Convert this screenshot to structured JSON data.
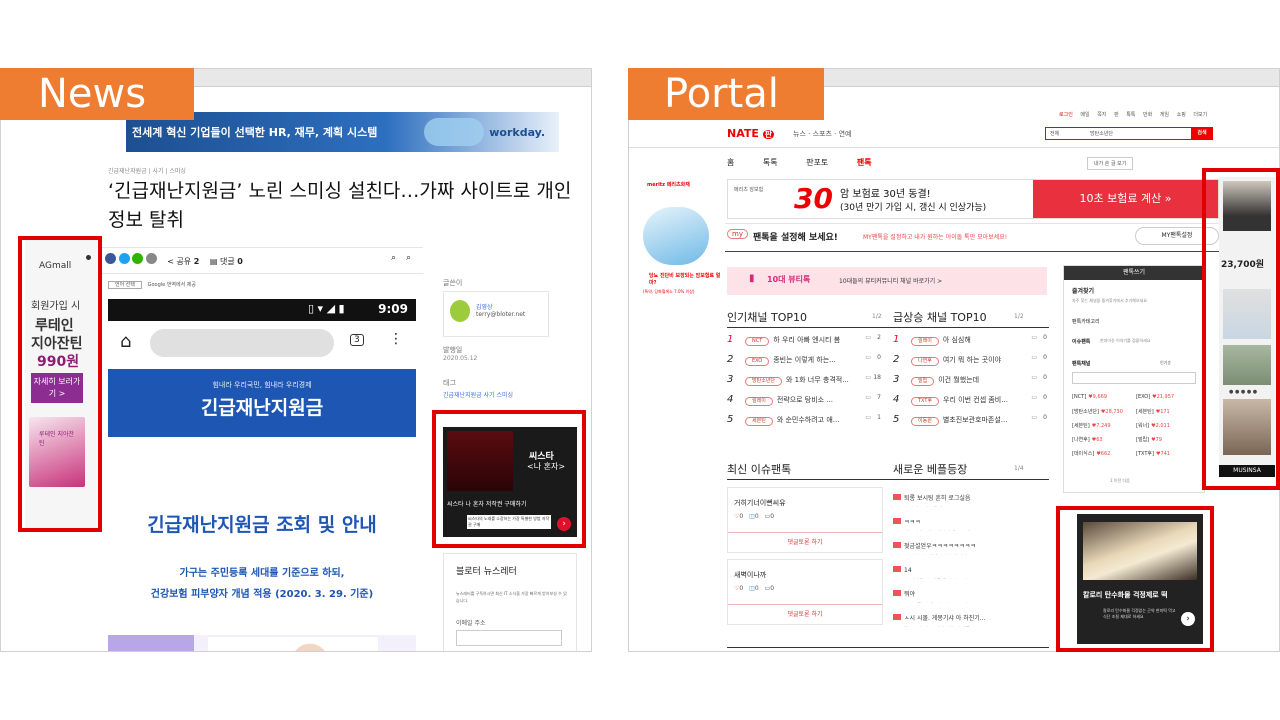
{
  "labels": {
    "news": "News",
    "portal": "Portal"
  },
  "news": {
    "top_banner": {
      "text": "전세계 혁신 기업들이 선택한 HR, 재무, 계획 시스템",
      "brand": "workday."
    },
    "breadcrumb": "긴급재난지원금 | 사기 | 스미싱",
    "headline": "‘긴급재난지원금’ 노린 스미싱 설친다…가짜 사이트로 개인정보 탈취",
    "share": {
      "share_label": "공유",
      "share_count": "2",
      "comment_label": "댓글",
      "comment_count": "0"
    },
    "translate": {
      "select": "언어 선택",
      "note": "Google 번역에서 제공"
    },
    "phone": {
      "time": "9:09",
      "tab_count": "3"
    },
    "gov_banner": {
      "tagline": "힘내라 우리국민, 힘내라 우리경제",
      "title": "긴급재난지원금"
    },
    "article_heading": "긴급재난지원금 조회 및 안내",
    "article_sub1": "가구는 주민등록 세대를 기준으로 하되,",
    "article_sub2": "건강보험 피부양자 개념 적용 (2020. 3. 29. 기준)",
    "sidebar": {
      "writer_label": "글쓴이",
      "writer_name": "김영상",
      "writer_email": "terry@bloter.net",
      "date_label": "발행일",
      "date": "2020.05.12",
      "tag_label": "태그",
      "tags": "긴급재난지원금 사기 스미싱",
      "ad_title": "씨스타",
      "ad_sub": "<나 혼자>",
      "ad_button": "씨스타 나 혼자 저작권 구매하기",
      "ad_desc": "씨스타의 노래를 소장하는 가장 특별한 방법 저작권 구매",
      "newsletter_title": "블로터 뉴스레터",
      "newsletter_desc": "뉴스레터를 구독하시면 최신 IT 소식을 가장 빠르게 받아보실 수 있습니다.",
      "email_label": "이메일 주소"
    },
    "left_ad": {
      "brand": "AGmall",
      "line1": "회원가입 시",
      "line2": "루테인",
      "line3": "지아잔틴",
      "price": "990원",
      "cta": "자세히 보러가기 >",
      "box": "루테인 지아잔틴"
    }
  },
  "portal": {
    "top_links": [
      "로그인",
      "메일",
      "쪽지",
      "판",
      "톡톡",
      "만화",
      "게임",
      "쇼핑",
      "더보기"
    ],
    "logo": {
      "nate": "NATE",
      "pan": "판"
    },
    "nav": [
      "뉴스",
      "스포츠",
      "연예"
    ],
    "search": {
      "scope": "전체",
      "query": "방탄소년단",
      "button": "검색"
    },
    "tabs": [
      "홈",
      "톡톡",
      "판포토",
      "팬톡"
    ],
    "write_button": "내가 쓴 글 보기",
    "meritz_ad": {
      "brand": "meritz 메리츠화재",
      "product": "메리츠 암보험",
      "big": "30",
      "headline": "암 보험료 30년 동결!",
      "sub": "(30년 만기 가입 시, 갱신 시 인상가능)",
      "cta": "10초 보험료 계산 »",
      "side_q": "당뇨 진단비 보장되는 암보험료 얼마?",
      "side_sub": "(특약, 당화혈색소 7.0% 이상)"
    },
    "my_bar": {
      "badge": "my",
      "text": "팬톡을 설정해 보세요!",
      "desc": "MY팬톡을 설정하고 내가 원하는 아이돌 톡만 모아보세요!",
      "button": "MY팬톡설정"
    },
    "beauty_banner": {
      "badge": "10대 뷰티톡",
      "text": "10대들의 뷰티커뮤니티 채널 바로가기 >"
    },
    "popular": {
      "title": "인기채널 TOP10",
      "page": "1/2",
      "items": [
        {
          "rank": "1",
          "channel": "NCT",
          "title": "하 우리 아빠 엔시티 봄",
          "count": "2"
        },
        {
          "rank": "2",
          "channel": "EXO",
          "title": "종빈는 이렇게 하는...",
          "count": "0"
        },
        {
          "rank": "3",
          "channel": "방탄소년단",
          "title": "와 1화 너무 충격적...",
          "count": "18"
        },
        {
          "rank": "4",
          "channel": "릴레이",
          "title": "전략으로 탕비소 ...",
          "count": "7"
        },
        {
          "rank": "5",
          "channel": "세븐틴",
          "title": "와 순민수하려고 애...",
          "count": "1"
        }
      ]
    },
    "rising": {
      "title": "급상승 채널 TOP10",
      "page": "1/2",
      "items": [
        {
          "rank": "1",
          "channel": "릴레이",
          "title": "아 심심해",
          "count": "0"
        },
        {
          "rank": "2",
          "channel": "나연후",
          "title": "여기 뭐 하는 곳이야",
          "count": "0"
        },
        {
          "rank": "3",
          "channel": "빌립",
          "title": "이건 뭘했는데",
          "count": "0"
        },
        {
          "rank": "4",
          "channel": "TXT후",
          "title": "우리 이번 컨셉 좀비...",
          "count": "0"
        },
        {
          "rank": "5",
          "channel": "이동원",
          "title": "별초진보관호마존설...",
          "count": "0"
        }
      ]
    },
    "issue": {
      "title": "최신 이슈팬톡",
      "page": "1/4",
      "cards": [
        {
          "title": "거히기너이뻔씨유",
          "likes": "0",
          "views": "0",
          "comments": "0",
          "button": "댓글토론 하기"
        },
        {
          "title": "새벽이나까",
          "likes": "0",
          "views": "0",
          "comments": "0",
          "button": "댓글토론 하기"
        }
      ]
    },
    "best": {
      "title": "새로운 베플등장",
      "page": "1/4",
      "items": [
        {
          "title": "퇴롱 보시팅 흔히 로그실음",
          "sub": "흐퍼이스 아이유쉼 (2)"
        },
        {
          "title": "ㅋㅋㅋ",
          "sub": "엔시티엠그랜모대다사 우뇨르에 (58)"
        },
        {
          "title": "젖금설얻우ㅋㅋㅋㅋㅋㅋㅋㅋ",
          "sub": "아 마이이그헤셋먼아서 메커나 (36)"
        },
        {
          "title": "14",
          "sub": "팝 맵망률 보 텔물 유러가 요타 (6)"
        },
        {
          "title": "뭐야",
          "sub": "트보얻걸린 멩부성 아브는 주이ㅋ (88)"
        },
        {
          "title": "ㅅ시 시몰. 게몽기샤 아 하진기...",
          "sub": "연시로버 감조 와비 상분 바렌들 (22)"
        }
      ]
    },
    "right_panel": {
      "write_button": "팬톡쓰기",
      "favorites": "즐겨찾기",
      "favorites_desc": "자주 찾는 채널을 즐겨찾기에서 추가해보세요",
      "category": "팬톡카테고리",
      "issue_label": "이슈팬톡",
      "issue_desc": "한대이슈 이야기를 접을하세요",
      "channels_title": "팬톡채널",
      "channels_sort": "인기순",
      "channels": [
        {
          "name": "[NCT]",
          "count": "9,669"
        },
        {
          "name": "[EXO]",
          "count": "21,957"
        },
        {
          "name": "[방탄소년단]",
          "count": "28,730"
        },
        {
          "name": "[세븐틴]",
          "count": "171"
        },
        {
          "name": "[세븐틴]",
          "count": "7,249"
        },
        {
          "name": "[워너]",
          "count": "2,011"
        },
        {
          "name": "[나연후]",
          "count": "63"
        },
        {
          "name": "[빌립]",
          "count": "79"
        },
        {
          "name": "[데이식스]",
          "count": "662"
        },
        {
          "name": "[TXT후]",
          "count": "741"
        }
      ],
      "pager": "1 이전 다음"
    },
    "musinsa_ad": {
      "price": "23,700원",
      "brand": "MUSINSA"
    },
    "food_ad": {
      "title": "칼로리 탄수화물 걱정제로 떡",
      "desc": "칼로리 탄수화물 걱정없는 곤약 현미떡 먹고 식단 조절 제대로 하세요"
    }
  }
}
